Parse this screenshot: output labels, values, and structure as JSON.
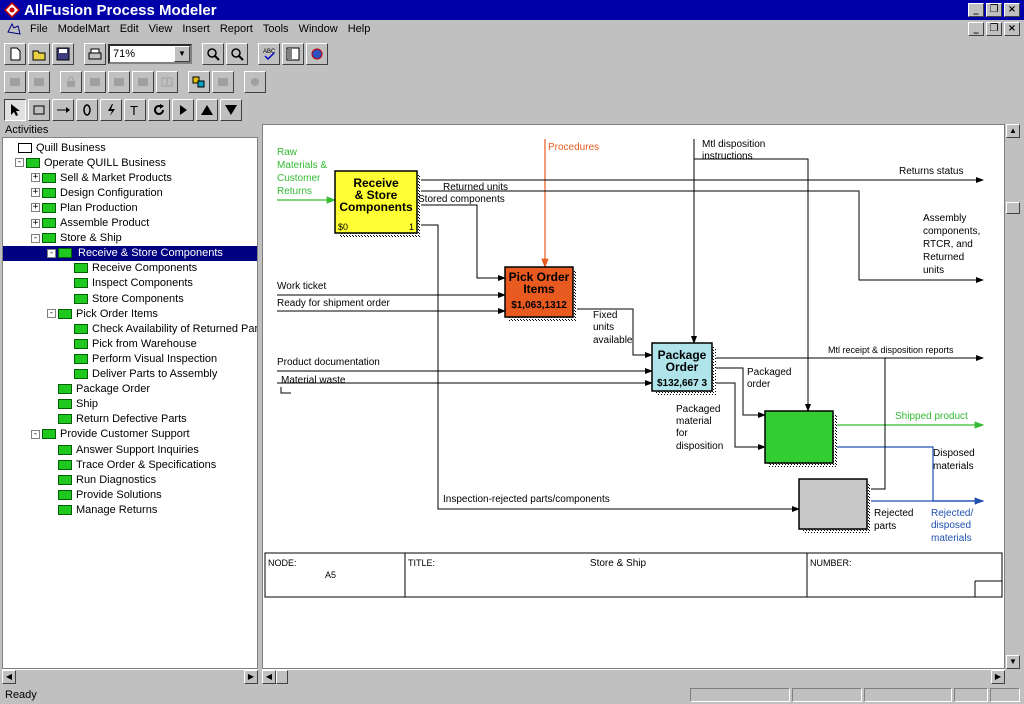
{
  "window": {
    "title": "AllFusion Process Modeler"
  },
  "menu": [
    "File",
    "ModelMart",
    "Edit",
    "View",
    "Insert",
    "Report",
    "Tools",
    "Window",
    "Help"
  ],
  "toolbar": {
    "zoom": "71%"
  },
  "panel": {
    "header": "Activities"
  },
  "tree": [
    {
      "label": "Quill Business",
      "level": 0,
      "exp": ""
    },
    {
      "label": "Operate QUILL Business",
      "level": 1,
      "exp": "-"
    },
    {
      "label": "Sell & Market Products",
      "level": 2,
      "exp": "+"
    },
    {
      "label": "Design Configuration",
      "level": 2,
      "exp": "+"
    },
    {
      "label": "Plan Production",
      "level": 2,
      "exp": "+"
    },
    {
      "label": "Assemble Product",
      "level": 2,
      "exp": "+"
    },
    {
      "label": "Store & Ship",
      "level": 2,
      "exp": "-"
    },
    {
      "label": "Receive & Store Components",
      "level": 3,
      "exp": "-",
      "selected": true
    },
    {
      "label": "Receive Components",
      "level": 4,
      "exp": ""
    },
    {
      "label": "Inspect Components",
      "level": 4,
      "exp": ""
    },
    {
      "label": "Store Components",
      "level": 4,
      "exp": ""
    },
    {
      "label": "Pick Order Items",
      "level": 3,
      "exp": "-"
    },
    {
      "label": "Check Availability of Returned Part",
      "level": 4,
      "exp": ""
    },
    {
      "label": "Pick from Warehouse",
      "level": 4,
      "exp": ""
    },
    {
      "label": "Perform Visual Inspection",
      "level": 4,
      "exp": ""
    },
    {
      "label": "Deliver Parts to Assembly",
      "level": 4,
      "exp": ""
    },
    {
      "label": "Package Order",
      "level": 3,
      "exp": ""
    },
    {
      "label": "Ship",
      "level": 3,
      "exp": ""
    },
    {
      "label": "Return Defective Parts",
      "level": 3,
      "exp": ""
    },
    {
      "label": "Provide Customer Support",
      "level": 2,
      "exp": "-"
    },
    {
      "label": "Answer Support Inquiries",
      "level": 3,
      "exp": ""
    },
    {
      "label": "Trace Order & Specifications",
      "level": 3,
      "exp": ""
    },
    {
      "label": "Run Diagnostics",
      "level": 3,
      "exp": ""
    },
    {
      "label": "Provide Solutions",
      "level": 3,
      "exp": ""
    },
    {
      "label": "Manage Returns",
      "level": 3,
      "exp": ""
    }
  ],
  "diagram": {
    "box1": {
      "line1": "Receive",
      "line2": "& Store",
      "line3": "Components",
      "cost": "$0",
      "num": "1",
      "color": "#ffff33"
    },
    "box2": {
      "line1": "Pick Order",
      "line2": "Items",
      "cost": "$1,063,1312",
      "color": "#e85a20"
    },
    "box3": {
      "line1": "Package",
      "line2": "Order",
      "cost": "$132,667 3",
      "color": "#aee4ea"
    },
    "box4": {
      "color": "#33cc33"
    },
    "box5": {
      "color": "#c8c8c8"
    },
    "labels": {
      "raw1": "Raw",
      "raw2": "Materials &",
      "raw3": "Customer",
      "raw4": "Returns",
      "procedures": "Procedures",
      "mtl1": "Mtl disposition",
      "mtl2": "instructions",
      "returns_status": "Returns status",
      "returned_units": "Returned units",
      "stored_components": "Stored components",
      "asm1": "Assembly",
      "asm2": "components,",
      "asm3": "RTCR, and",
      "asm4": "Returned",
      "asm5": "units",
      "work_ticket": "Work ticket",
      "ready_order": "Ready for shipment order",
      "fixed1": "Fixed",
      "fixed2": "units",
      "fixed3": "available",
      "product_doc": "Product documentation",
      "material_waste": "Material waste",
      "mtl_receipt": "Mtl receipt & disposition reports",
      "pkg1": "Packaged",
      "pkg2": "order",
      "shipped": "Shipped product",
      "pm1": "Packaged",
      "pm2": "material",
      "pm3": "for",
      "pm4": "disposition",
      "disp1": "Disposed",
      "disp2": "materials",
      "insp": "Inspection-rejected parts/components",
      "rej1": "Rejected",
      "rej2": "parts",
      "rd1": "Rejected/",
      "rd2": "disposed",
      "rd3": "materials"
    },
    "footer": {
      "node_label": "NODE:",
      "node_value": "A5",
      "title_label": "TITLE:",
      "title_value": "Store & Ship",
      "number_label": "NUMBER:"
    }
  },
  "colors": {
    "green_arrow": "#33bb33",
    "red_arrow": "#e85a20",
    "blue_arrow": "#2050b0"
  },
  "status": {
    "text": "Ready"
  }
}
